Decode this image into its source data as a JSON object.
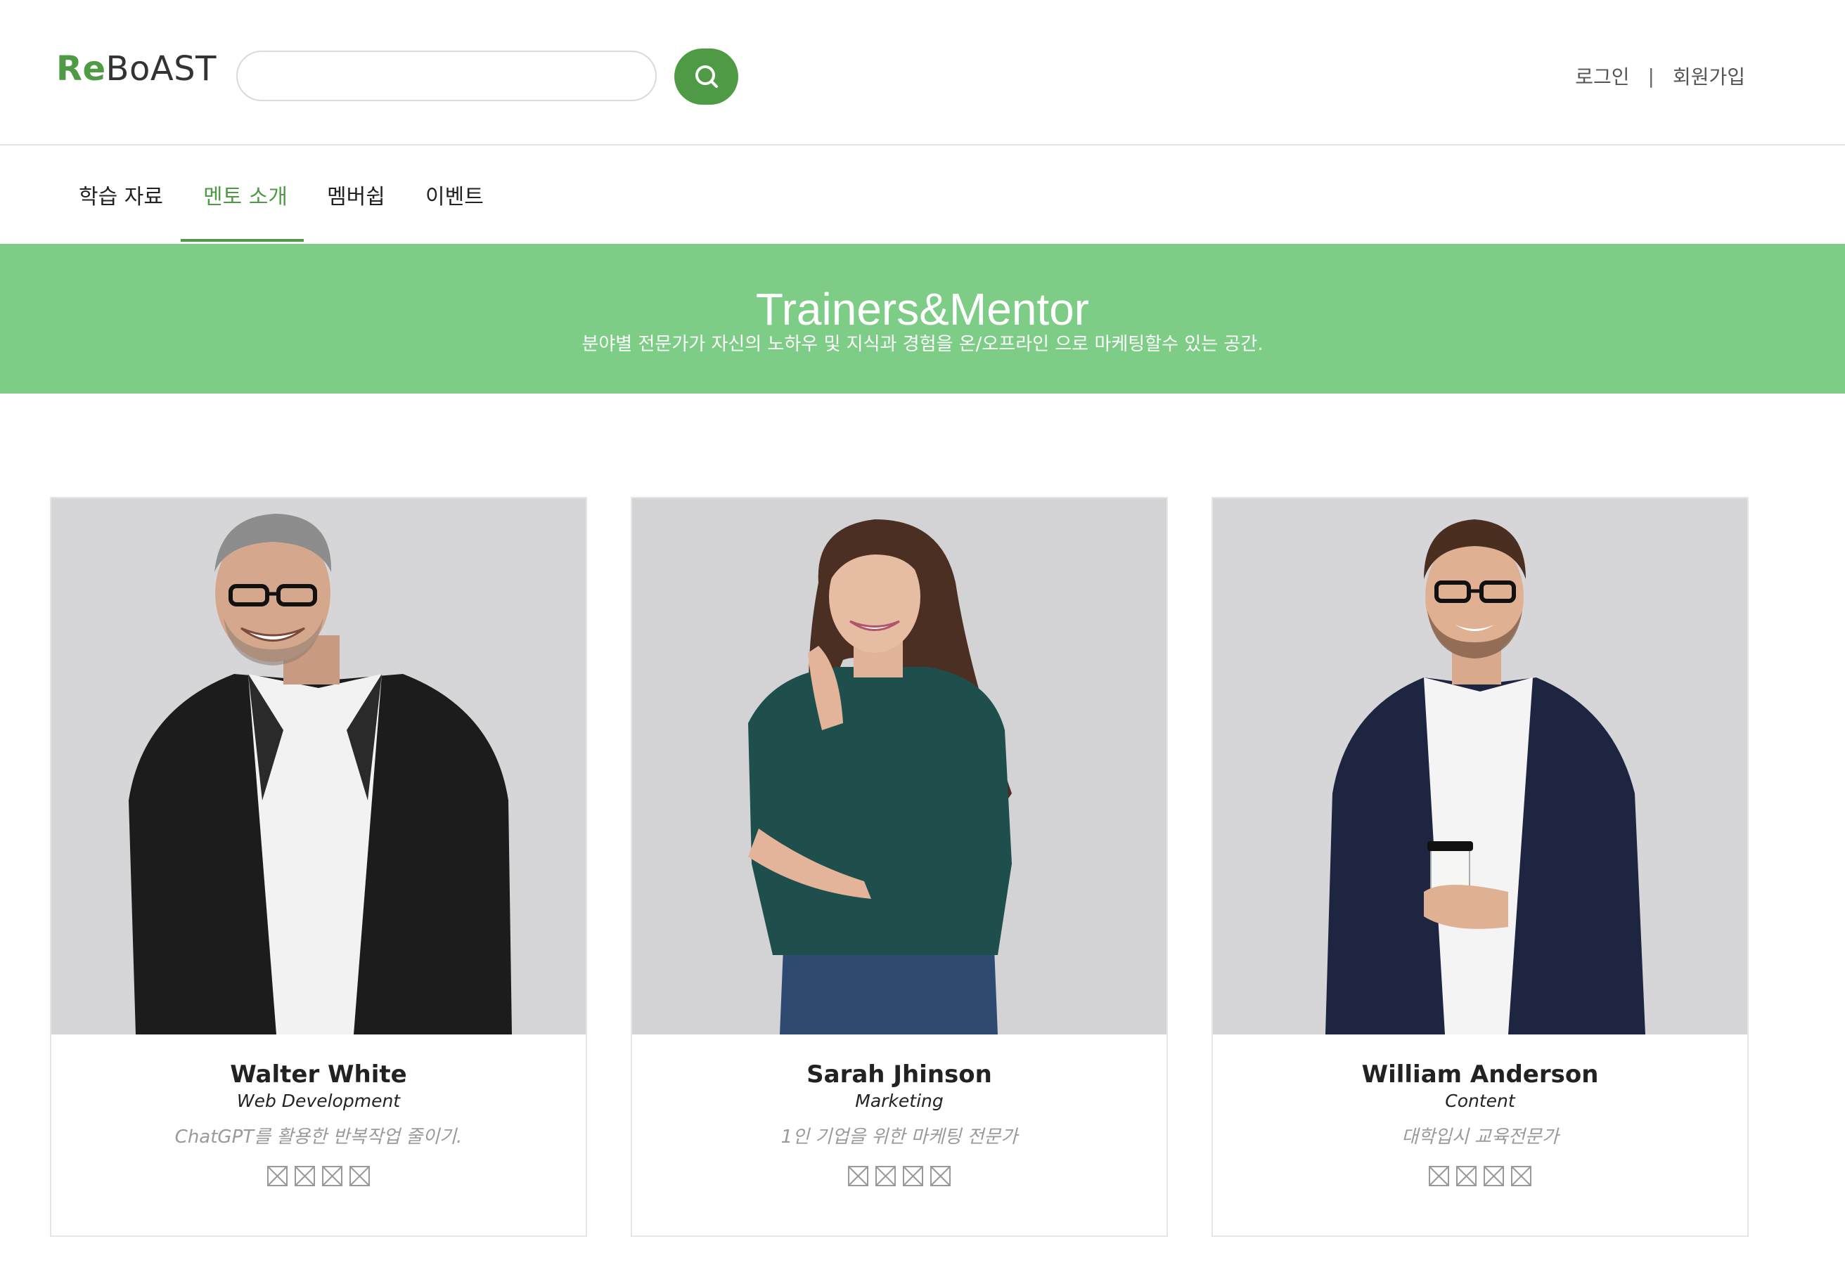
{
  "header": {
    "logo_re": "Re",
    "logo_rest": "BoAST",
    "search_placeholder": "",
    "login": "로그인",
    "separator": "|",
    "signup": "회원가입"
  },
  "nav": {
    "items": [
      {
        "label": "학습 자료",
        "active": false
      },
      {
        "label": "멘토 소개",
        "active": true
      },
      {
        "label": "멤버쉽",
        "active": false
      },
      {
        "label": "이벤트",
        "active": false
      }
    ]
  },
  "banner": {
    "title": "Trainers&Mentor",
    "subtitle": "분야별 전문가가 자신의 노하우 및 지식과 경험을 온/오프라인 으로 마케팅할수 있는 공간."
  },
  "mentors": [
    {
      "name": "Walter White",
      "role": "Web Development",
      "desc": "ChatGPT를 활용한 반복작업 줄이기."
    },
    {
      "name": "Sarah Jhinson",
      "role": "Marketing",
      "desc": "1인 기업을 위한 마케팅 전문가"
    },
    {
      "name": "William Anderson",
      "role": "Content",
      "desc": "대학입시 교육전문가"
    }
  ],
  "colors": {
    "brand_green": "#4f9a45",
    "banner_green": "#7ecd86",
    "photo_bg": "#d8d8da"
  },
  "icons": {
    "search": "search-icon",
    "social_placeholder": "broken-image-icon"
  }
}
